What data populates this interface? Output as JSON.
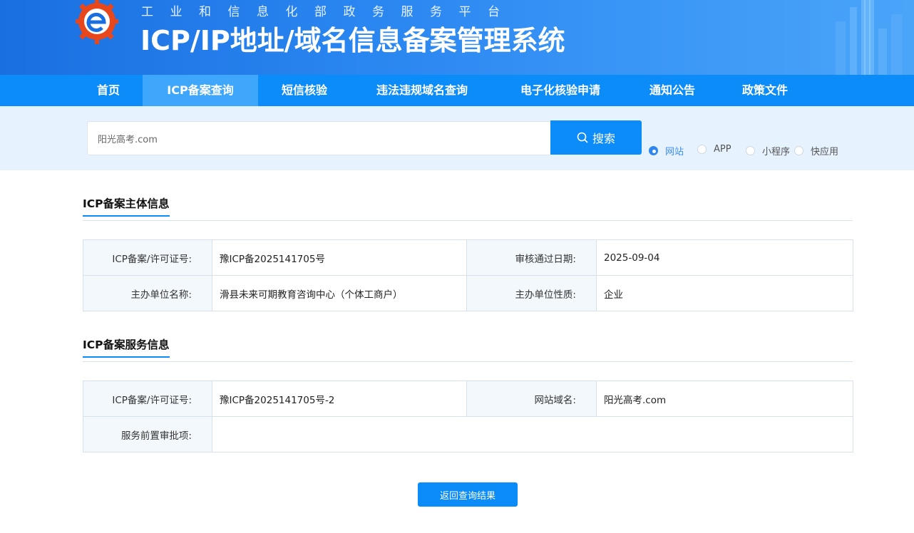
{
  "header": {
    "subtitle": "工业和信息化部政务服务平台",
    "title": "ICP/IP地址/域名信息备案管理系统",
    "logo_icon": "gear-e-logo-icon"
  },
  "nav": {
    "items": [
      {
        "label": "首页"
      },
      {
        "label": "ICP备案查询"
      },
      {
        "label": "短信核验"
      },
      {
        "label": "违法违规域名查询"
      },
      {
        "label": "电子化核验申请"
      },
      {
        "label": "通知公告"
      },
      {
        "label": "政策文件"
      }
    ],
    "active_index": 1
  },
  "search": {
    "value": "阳光高考.com",
    "button_label": "搜索",
    "button_icon": "search-icon",
    "types": [
      {
        "label": "网站",
        "checked": true
      },
      {
        "label": "APP",
        "checked": false
      },
      {
        "label": "小程序",
        "checked": false
      },
      {
        "label": "快应用",
        "checked": false
      }
    ]
  },
  "subject": {
    "title": "ICP备案主体信息",
    "rows": [
      {
        "label1": "ICP备案/许可证号:",
        "value1": "豫ICP备2025141705号",
        "label2": "审核通过日期:",
        "value2": "2025-09-04"
      },
      {
        "label1": "主办单位名称:",
        "value1": "滑县未来可期教育咨询中心（个体工商户）",
        "label2": "主办单位性质:",
        "value2": "企业"
      }
    ]
  },
  "service": {
    "title": "ICP备案服务信息",
    "row1": {
      "label1": "ICP备案/许可证号:",
      "value1": "豫ICP备2025141705号-2",
      "label2": "网站域名:",
      "value2": "阳光高考.com"
    },
    "row2": {
      "label": "服务前置审批项:",
      "value": ""
    }
  },
  "back_button": {
    "label": "返回查询结果"
  },
  "colors": {
    "primary": "#0c8cf8",
    "nav_active": "#3ea6fb",
    "search_bg": "#e6f2fd",
    "label_bg": "#f3f8fc"
  }
}
